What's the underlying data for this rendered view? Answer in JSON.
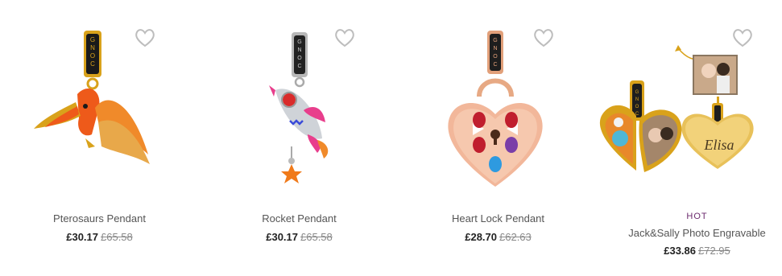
{
  "products": [
    {
      "name": "Pterosaurs Pendant",
      "price": "£30.17",
      "old_price": "£65.58",
      "badge": ""
    },
    {
      "name": "Rocket Pendant",
      "price": "£30.17",
      "old_price": "£65.58",
      "badge": ""
    },
    {
      "name": "Heart Lock Pendant",
      "price": "£28.70",
      "old_price": "£62.63",
      "badge": ""
    },
    {
      "name": "Jack&Sally Photo Engravable",
      "price": "£33.86",
      "old_price": "£72.95",
      "badge": "HOT"
    }
  ],
  "engraving_text": "Elisa",
  "bail_text": "GNOCE",
  "icons": {
    "wishlist": "heart-outline-icon"
  },
  "colors": {
    "hot_badge": "#6b2a6d",
    "price": "#222222",
    "old_price": "#888888",
    "heart_icon": "#bdbdbd"
  }
}
